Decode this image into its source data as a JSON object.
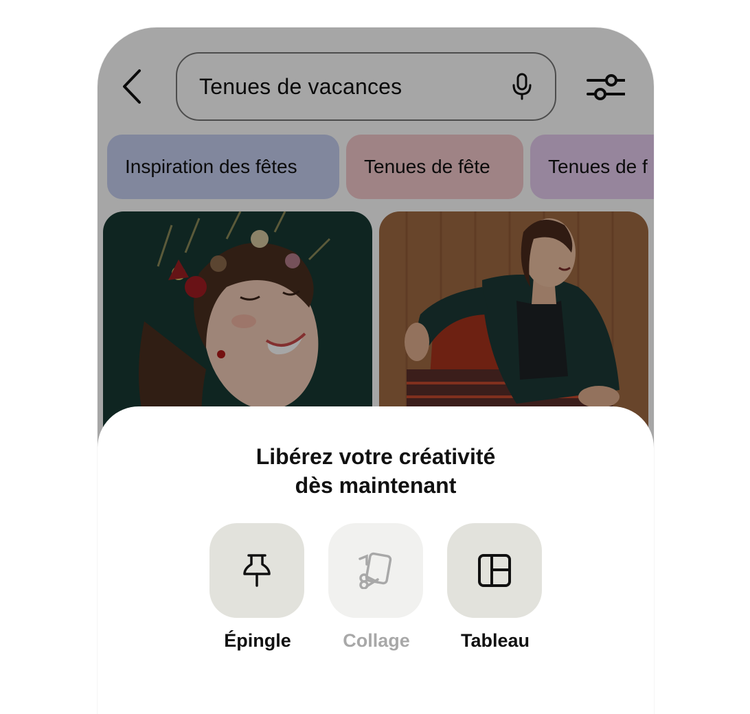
{
  "search": {
    "query": "Tenues de vacances"
  },
  "chips": [
    {
      "label": "Inspiration des fêtes",
      "color": "#c6cff2"
    },
    {
      "label": "Tenues de fête",
      "color": "#f4c9cd"
    },
    {
      "label": "Tenues de f",
      "color": "#e7cdf0"
    }
  ],
  "sheet": {
    "title_line1": "Libérez votre créativité",
    "title_line2": "dès maintenant",
    "options": [
      {
        "label": "Épingle",
        "icon": "pin-icon",
        "enabled": true
      },
      {
        "label": "Collage",
        "icon": "scissors-icon",
        "enabled": false
      },
      {
        "label": "Tableau",
        "icon": "board-icon",
        "enabled": true
      }
    ]
  },
  "colors": {
    "overlay": "rgba(0,0,0,0.35)",
    "option_bg": "#e2e2dc",
    "option_disabled_bg": "#f1f1ef",
    "disabled_text": "#a8a8a8"
  }
}
